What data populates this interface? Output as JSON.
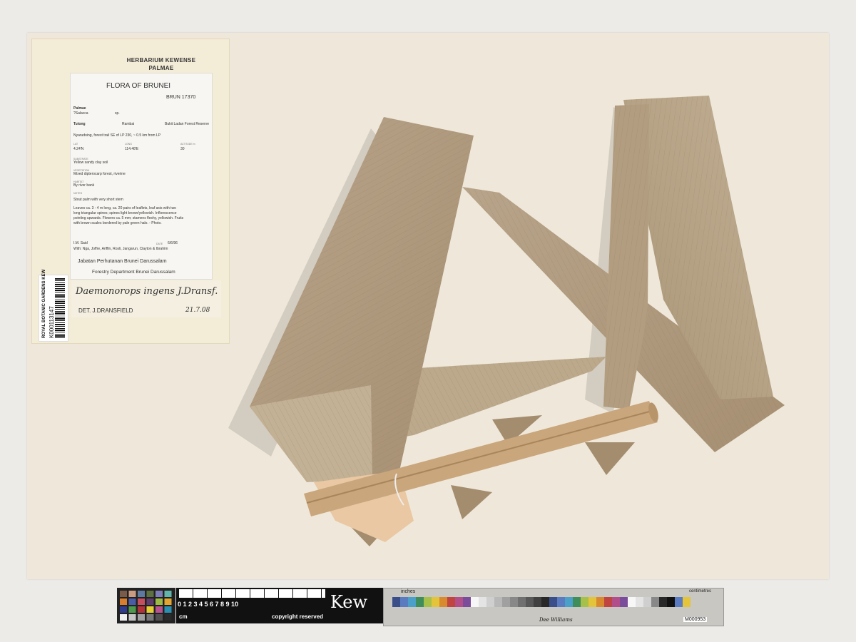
{
  "herbarium": {
    "line1": "HERBARIUM KEWENSE",
    "line2": "PALMAE"
  },
  "label": {
    "title": "FLORA OF BRUNEI",
    "number": "BRUN 17370",
    "family": "Palmae",
    "genus": "?Salacca",
    "sp": "sp.",
    "district": "Tutong",
    "area": "Rambai",
    "reserve": "Bukit Ladan Forest Reserve",
    "locality": "Nyarudoing, forest trail SE of LP 230, ~ 0.5 km from LP",
    "lat_head": "LAT",
    "lat": "4.24'N",
    "long_head": "LONG",
    "long": "114.48'E",
    "alt_head": "ALTITUDE m",
    "alt": "30",
    "substrate_head": "SUBSTRATE",
    "substrate": "Yellow sandy clay soil",
    "vegetation_head": "VEGETATION",
    "vegetation": "Mixed dipterocarp forest, riverine",
    "habitat_head": "HABITAT",
    "habitat": "By river bank",
    "notes_head": "NOTES",
    "notes1": "Stout palm with very short stem",
    "desc1": "Leaves ca. 3 - 4 m long, ca. 20 pairs of leaflets, leaf axis with two",
    "desc2": "long triangular spines; spines light brown/yellowish. Inflorescence",
    "desc3": "pointing upwards. Flowers ca. 5 mm; stamens fleshy, yellowish. Fruits",
    "desc4": "with brown scales bordered by pale green halo. - Photo.",
    "collector": "I.M. Said",
    "date_head": "DATE",
    "date": "6/6/96",
    "with": "With: Nga, Joffre, Ariffin, Rosli, Jangarun, Clayton & Ibrahim",
    "dept_malay": "Jabatan Perhutanan Brunei Darussalam",
    "dept_en": "Forestry Department Brunei Darussalam"
  },
  "determination": {
    "name": "Daemonorops ingens J.Dransf.",
    "det": "DET. J.DRANSFIELD",
    "date": "21.7.08"
  },
  "barcode": {
    "institution": "ROYAL BOTANIC GARDENS KEW",
    "code": "K000113147"
  },
  "scale": {
    "numbers": "0  1  2  3  4  5  6  7  8  9  10",
    "unit": "cm",
    "copyright": "copyright reserved",
    "brand": "Kew",
    "inches": "inches",
    "centimetres": "centimetres",
    "maker": "Dee Williams",
    "code": "M000953"
  }
}
